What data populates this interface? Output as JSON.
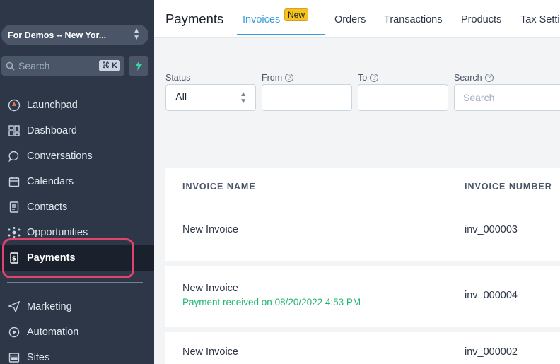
{
  "sidebar": {
    "location": "For Demos -- New Yor...",
    "search_placeholder": "Search",
    "shortcut": "⌘ K",
    "items": [
      {
        "label": "Launchpad",
        "icon": "rocket-icon"
      },
      {
        "label": "Dashboard",
        "icon": "grid-icon"
      },
      {
        "label": "Conversations",
        "icon": "chat-icon"
      },
      {
        "label": "Calendars",
        "icon": "calendar-icon"
      },
      {
        "label": "Contacts",
        "icon": "contacts-icon"
      },
      {
        "label": "Opportunities",
        "icon": "network-icon"
      },
      {
        "label": "Payments",
        "icon": "payment-icon",
        "active": true
      }
    ],
    "items_after": [
      {
        "label": "Marketing",
        "icon": "send-icon"
      },
      {
        "label": "Automation",
        "icon": "automation-icon"
      },
      {
        "label": "Sites",
        "icon": "sites-icon"
      }
    ]
  },
  "header": {
    "title": "Payments",
    "tabs": [
      {
        "label": "Invoices",
        "active": true,
        "badge": "New"
      },
      {
        "label": "Orders"
      },
      {
        "label": "Transactions"
      },
      {
        "label": "Products"
      },
      {
        "label": "Tax Setti"
      }
    ]
  },
  "filters": {
    "status_label": "Status",
    "status_value": "All",
    "from_label": "From",
    "to_label": "To",
    "search_label": "Search",
    "search_placeholder": "Search"
  },
  "table": {
    "columns": [
      "INVOICE NAME",
      "INVOICE NUMBER"
    ],
    "rows": [
      {
        "name": "New Invoice",
        "note": "",
        "number": "inv_000003"
      },
      {
        "name": "New Invoice",
        "note": "Payment received on 08/20/2022 4:53 PM",
        "number": "inv_000004"
      },
      {
        "name": "New Invoice",
        "note": "",
        "number": "inv_000002"
      }
    ]
  },
  "colors": {
    "sidebar_bg": "#2d3748",
    "accent": "#3b9cd9",
    "highlight": "#e0446e",
    "success": "#22b573",
    "badge": "#f6c21c"
  }
}
